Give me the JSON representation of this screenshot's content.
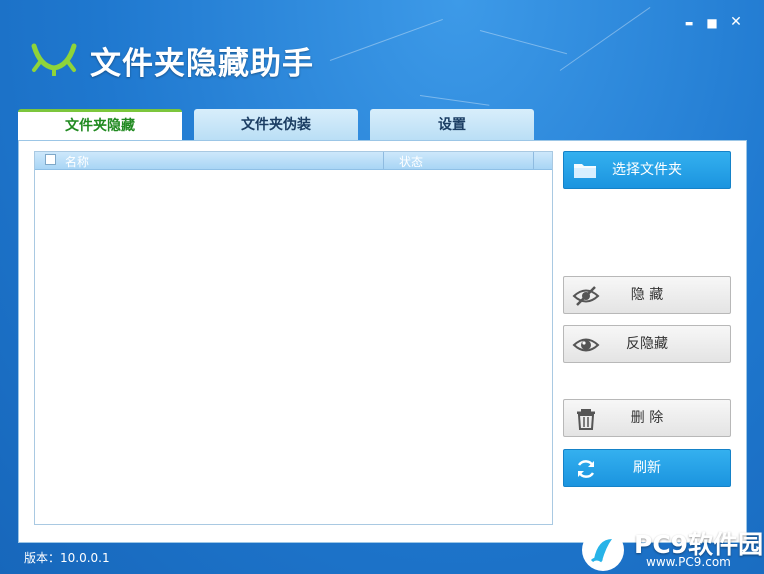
{
  "app": {
    "title": "文件夹隐藏助手"
  },
  "window_controls": {
    "minimize": "▬",
    "maximize": "■",
    "close": "✕"
  },
  "tabs": [
    {
      "label": "文件夹隐藏",
      "active": true
    },
    {
      "label": "文件夹伪装",
      "active": false
    },
    {
      "label": "设置",
      "active": false
    }
  ],
  "list": {
    "columns": [
      "名称",
      "状态"
    ],
    "rows": []
  },
  "buttons": {
    "select_folder": {
      "label": "选择文件夹",
      "icon": "folder-icon"
    },
    "hide": {
      "label": "隐 藏",
      "icon": "eye-slash-icon"
    },
    "unhide": {
      "label": "反隐藏",
      "icon": "eye-icon"
    },
    "delete": {
      "label": "删 除",
      "icon": "trash-icon"
    },
    "refresh": {
      "label": "刷新",
      "icon": "refresh-icon"
    }
  },
  "footer": {
    "version": "版本：10.0.0.1"
  },
  "watermark": {
    "brand": "PC9软件园",
    "url": "www.PC9.com"
  },
  "colors": {
    "accent_blue": "#1b94df",
    "active_tab_text": "#208a20",
    "logo_green": "#8fd43a"
  }
}
